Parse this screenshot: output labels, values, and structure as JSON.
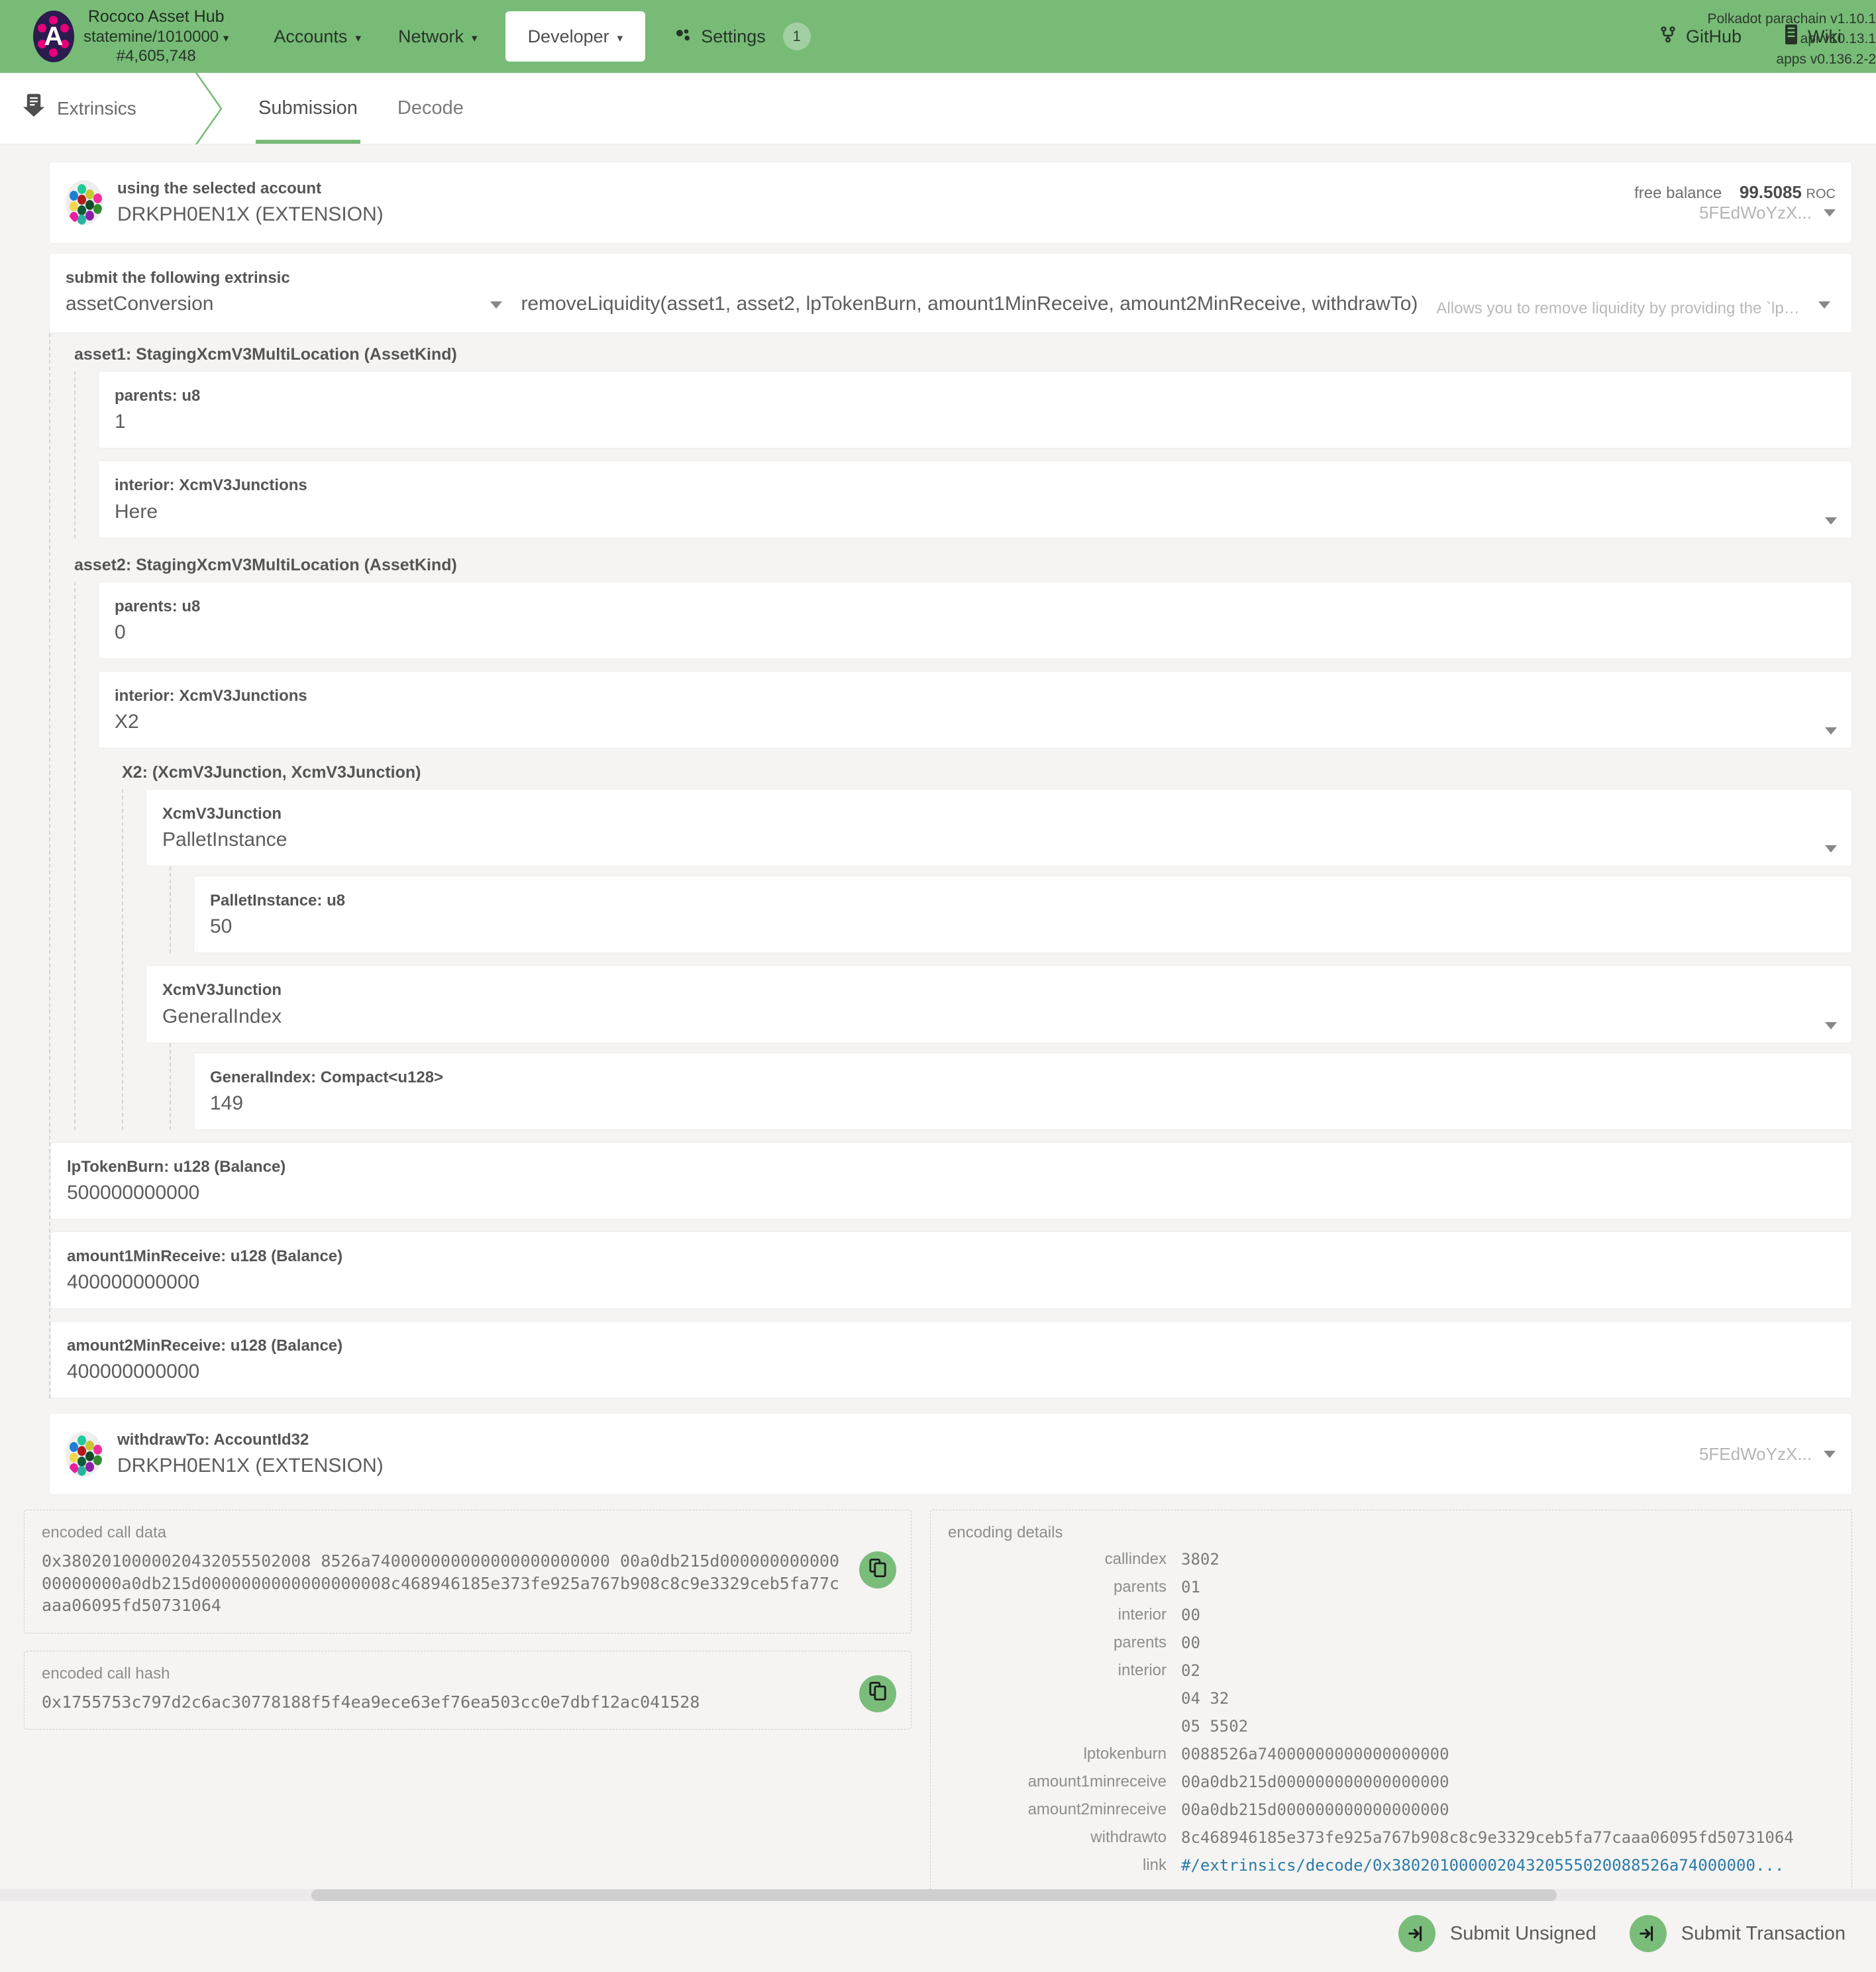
{
  "header": {
    "chain_name": "Rococo Asset Hub",
    "chain_spec": "statemine/1010000",
    "block_number": "#4,605,748",
    "nav": [
      {
        "label": "Accounts",
        "has_caret": true,
        "active": false
      },
      {
        "label": "Network",
        "has_caret": true,
        "active": false
      },
      {
        "label": "Developer",
        "has_caret": true,
        "active": true
      },
      {
        "label": "Settings",
        "has_caret": false,
        "active": false,
        "badge": "1"
      }
    ],
    "links": [
      {
        "label": "GitHub",
        "icon": "github-icon"
      },
      {
        "label": "Wiki",
        "icon": "book-icon"
      }
    ],
    "versions": [
      "Polkadot parachain v1.10.1",
      "api v10.13.1",
      "apps v0.136.2-2"
    ]
  },
  "breadcrumb": {
    "icon": "extrinsics-icon",
    "label": "Extrinsics"
  },
  "tabs": [
    {
      "label": "Submission",
      "active": true
    },
    {
      "label": "Decode",
      "active": false
    }
  ],
  "account": {
    "label": "using the selected account",
    "value": "DRKPH0EN1X (EXTENSION)",
    "balance_label": "free balance",
    "balance_value": "99.5085",
    "balance_unit": "ROC",
    "address_short": "5FEdWoYzX..."
  },
  "extrinsic": {
    "label": "submit the following extrinsic",
    "pallet": "assetConversion",
    "method": "removeLiquidity(asset1, asset2, lpTokenBurn, amount1MinReceive, amount2MinReceive, withdrawTo)",
    "doc_hint": "Allows you to remove liquidity by providing the `lp_t..."
  },
  "params": {
    "asset1": {
      "heading": "asset1: StagingXcmV3MultiLocation (AssetKind)",
      "parents_label": "parents: u8",
      "parents_value": "1",
      "interior_label": "interior: XcmV3Junctions",
      "interior_value": "Here"
    },
    "asset2": {
      "heading": "asset2: StagingXcmV3MultiLocation (AssetKind)",
      "parents_label": "parents: u8",
      "parents_value": "0",
      "interior_label": "interior: XcmV3Junctions",
      "interior_value": "X2",
      "x2_heading": "X2: (XcmV3Junction, XcmV3Junction)",
      "junction1_label": "XcmV3Junction",
      "junction1_value": "PalletInstance",
      "junction1_inner_label": "PalletInstance: u8",
      "junction1_inner_value": "50",
      "junction2_label": "XcmV3Junction",
      "junction2_value": "GeneralIndex",
      "junction2_inner_label": "GeneralIndex: Compact<u128>",
      "junction2_inner_value": "149"
    },
    "lp_token_burn": {
      "label": "lpTokenBurn: u128 (Balance)",
      "value": "500000000000"
    },
    "amount1_min_receive": {
      "label": "amount1MinReceive: u128 (Balance)",
      "value": "400000000000"
    },
    "amount2_min_receive": {
      "label": "amount2MinReceive: u128 (Balance)",
      "value": "400000000000"
    },
    "withdraw_to": {
      "label": "withdrawTo: AccountId32",
      "value": "DRKPH0EN1X (EXTENSION)",
      "address_short": "5FEdWoYzX..."
    }
  },
  "encoded_call_data": {
    "label": "encoded call data",
    "value": "0x380201000002043205550200 88526a74000000000000000000 00a0db215d0000000000000000 0000a0db215d0000000000000000 008c468946185e373fe925a767b908c8c9e3329ceb5fa77caaa06095fd50731064",
    "value_display": "0x3802010000020432055502008 8526a740000000000000000000000 00a0db215d00000000000000000000a0db215d0000000000000000008c468946185e373fe925a767b908c8c9e3329ceb5fa77caaa06095fd50731064"
  },
  "encoded_call_hash": {
    "label": "encoded call hash",
    "value": "0x1755753c797d2c6ac30778188f5f4ea9ece63ef76ea503cc0e7dbf12ac041528"
  },
  "encoding_details": {
    "label": "encoding details",
    "rows": [
      {
        "key": "callindex",
        "value": "3802"
      },
      {
        "key": "parents",
        "value": "01"
      },
      {
        "key": "interior",
        "value": "00"
      },
      {
        "key": "parents",
        "value": "00"
      },
      {
        "key": "interior",
        "value": "02"
      },
      {
        "key": "",
        "value": "04 32"
      },
      {
        "key": "",
        "value": "05 5502"
      },
      {
        "key": "lptokenburn",
        "value": "0088526a74000000000000000000"
      },
      {
        "key": "amount1minreceive",
        "value": "00a0db215d000000000000000000"
      },
      {
        "key": "amount2minreceive",
        "value": "00a0db215d000000000000000000"
      },
      {
        "key": "withdrawto",
        "value": "8c468946185e373fe925a767b908c8c9e3329ceb5fa77caaa06095fd50731064"
      }
    ],
    "link_key": "link",
    "link_value": "#/extrinsics/decode/0x38020100000204320555020088526a74000000..."
  },
  "actions": {
    "submit_unsigned": "Submit Unsigned",
    "submit_transaction": "Submit Transaction"
  },
  "colors": {
    "brand_green": "#77bb77",
    "accent_green": "#7abd7a",
    "link_blue": "#2b7ba8"
  }
}
